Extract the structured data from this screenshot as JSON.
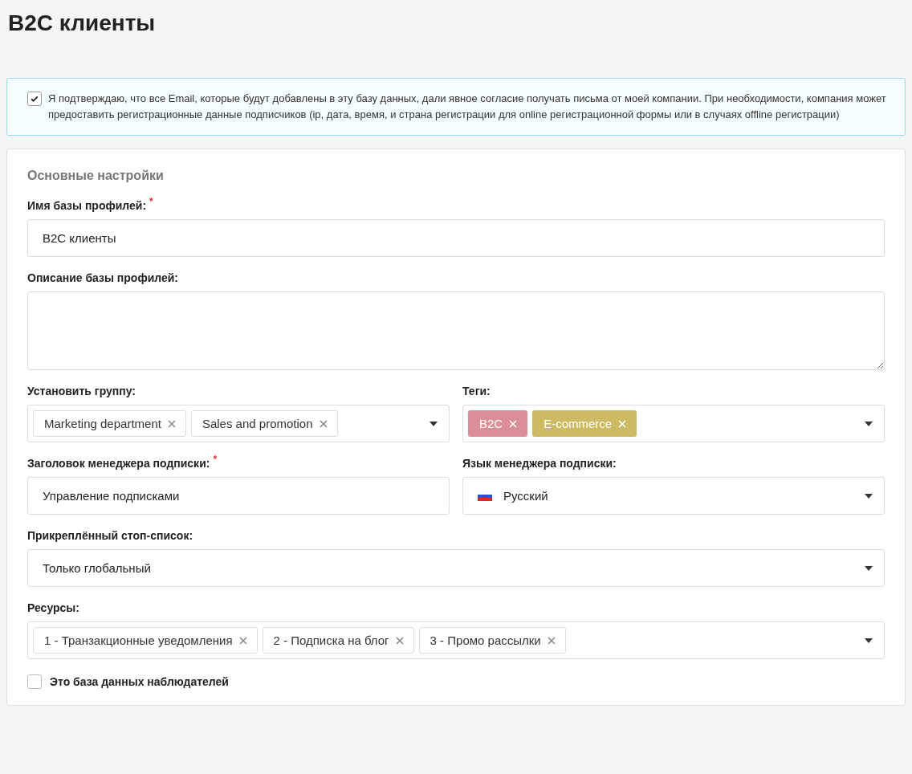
{
  "page_title": "B2C клиенты",
  "consent": {
    "checked": true,
    "text": "Я подтверждаю, что все Email, которые будут добавлены в эту базу данных, дали явное согласие получать письма от моей компании. При необходимости, компания может предоставить регистрационные данные подписчиков (ip, дата, время, и страна регистрации для online регистрационной формы или в случаях offline регистрации)"
  },
  "section_title": "Основные настройки",
  "required_mark": "*",
  "rows": [
    [
      {
        "kind": "text",
        "label": "Имя базы профилей:",
        "required": true,
        "value": "B2C клиенты"
      }
    ],
    [
      {
        "kind": "textarea",
        "label": "Описание базы профилей:",
        "required": false
      }
    ],
    [
      {
        "kind": "multiselect",
        "label": "Установить группу:",
        "required": false,
        "chips": [
          {
            "label": "Marketing department"
          },
          {
            "label": "Sales and promotion"
          }
        ]
      },
      {
        "kind": "multiselect",
        "label": "Теги:",
        "required": false,
        "chips": [
          {
            "label": "B2C",
            "color": "#db8e98"
          },
          {
            "label": "E-commerce",
            "color": "#cdbb63"
          }
        ]
      }
    ],
    [
      {
        "kind": "text",
        "label": "Заголовок менеджера подписки:",
        "required": true,
        "value": "Управление подписками"
      },
      {
        "kind": "select",
        "label": "Язык менеджера подписки:",
        "required": false,
        "value": "Русский",
        "flag": true
      }
    ],
    [
      {
        "kind": "select",
        "label": "Прикреплённый стоп-список:",
        "required": false,
        "value": "Только глобальный",
        "flag": false
      }
    ],
    [
      {
        "kind": "multiselect",
        "label": "Ресурсы:",
        "required": false,
        "chips": [
          {
            "label": "1 - Транзакционные уведомления"
          },
          {
            "label": "2 - Подписка на блог"
          },
          {
            "label": "3 - Промо рассылки"
          }
        ]
      }
    ]
  ],
  "observer": {
    "checked": false,
    "label": "Это база данных наблюдателей"
  }
}
